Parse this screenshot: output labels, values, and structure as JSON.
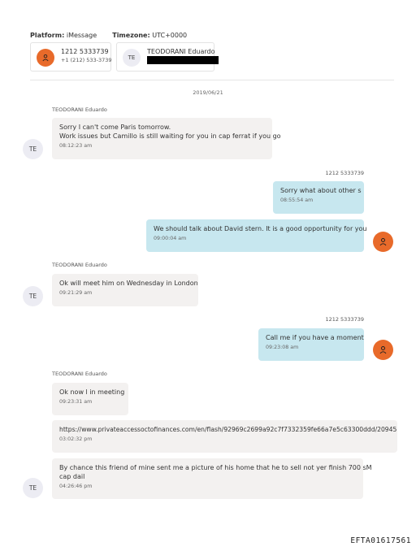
{
  "header": {
    "platform_label": "Platform:",
    "platform_value": "iMessage",
    "timezone_label": "Timezone:",
    "timezone_value": "UTC+0000"
  },
  "participants": [
    {
      "avatar": "person-icon",
      "name": "1212 5333739",
      "detail": "+1 (212) 533-3739"
    },
    {
      "avatar": "TE",
      "name": "TEODORANI Eduardo",
      "detail_redacted": true
    }
  ],
  "date": "2019/06/21",
  "messages": [
    {
      "direction": "in",
      "sender": "TEODORANI Eduardo",
      "avatar": "TE",
      "lines": [
        "Sorry I can't come Paris tomorrow.",
        "Work issues but Camillo is still waiting for you in cap ferrat if you go"
      ],
      "time": "08:12:23 am"
    },
    {
      "direction": "out",
      "sender": "1212 5333739",
      "lines": [
        "Sorry what about other s"
      ],
      "time": "08:55:54 am"
    },
    {
      "direction": "out",
      "lines": [
        "We should talk about David stern.   It is a good opportunity for you"
      ],
      "time": "09:00:04 am"
    },
    {
      "direction": "in",
      "sender": "TEODORANI Eduardo",
      "avatar": "TE",
      "lines": [
        "Ok will meet him on Wednesday in London"
      ],
      "time": "09:21:29 am"
    },
    {
      "direction": "out",
      "sender": "1212 5333739",
      "lines": [
        "Call me if you have a moment"
      ],
      "time": "09:23:08 am"
    },
    {
      "direction": "in",
      "sender": "TEODORANI Eduardo",
      "lines": [
        "Ok now l in meeting"
      ],
      "time": "09:23:31 am"
    },
    {
      "direction": "in",
      "lines": [
        "https://www.privateaccessoctofinances.com/en/flash/92969c2699a92c7f7332359fe66a7e5c63300ddd/20945"
      ],
      "time": "03:02:32 pm"
    },
    {
      "direction": "in",
      "avatar": "TE",
      "lines": [
        "By chance this friend of mine sent me a picture of his home that he to sell not yer finish 700 sM",
        "cap dail"
      ],
      "time": "04:26:46 pm"
    }
  ],
  "footer_id": "EFTA01617561",
  "colors": {
    "me_avatar": "#e86a2a",
    "out_bubble": "#c7e7ef",
    "in_bubble": "#f3f1f0",
    "te_avatar": "#ececf3"
  }
}
